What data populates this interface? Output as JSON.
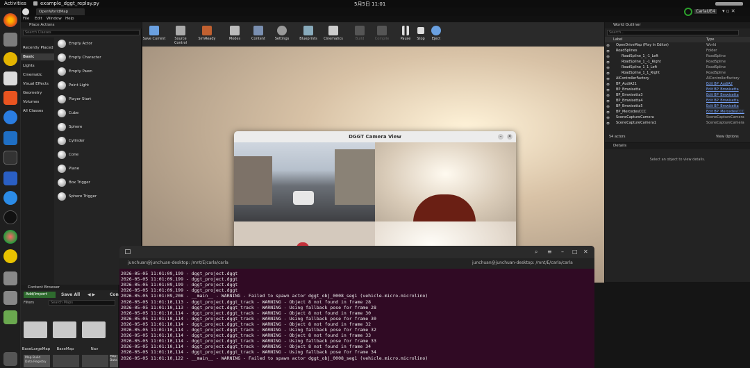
{
  "top_bar": {
    "activities": "Activities",
    "app_name": "example_dggt_replay.py",
    "clock": "5月5日  11:01"
  },
  "ue": {
    "tab": "OpenWorldMap",
    "menu": [
      "File",
      "Edit",
      "Window",
      "Help"
    ],
    "user_badge": "CarlaUE4",
    "place_actions": {
      "title": "Place Actions",
      "search_placeholder": "Search Classes",
      "categories": [
        "Recently Placed",
        "Basic",
        "Lights",
        "Cinematic",
        "Visual Effects",
        "Geometry",
        "Volumes",
        "All Classes"
      ],
      "items": [
        "Empty Actor",
        "Empty Character",
        "Empty Pawn",
        "Point Light",
        "Player Start",
        "Cube",
        "Sphere",
        "Cylinder",
        "Cone",
        "Plane",
        "Box Trigger",
        "Sphere Trigger"
      ]
    },
    "toolbar": [
      "Save Current",
      "Source Control",
      "SimReady",
      "Modes",
      "Content",
      "Settings",
      "Blueprints",
      "Cinematics",
      "Build",
      "Compile",
      "Pause",
      "Stop",
      "Eject"
    ],
    "outliner": {
      "title": "World Outliner",
      "search_placeholder": "Search...",
      "col_label": "Label",
      "col_type": "Type",
      "rows": [
        {
          "label": "OpenDriveMap (Play In Editor)",
          "type": "World",
          "link": false
        },
        {
          "label": "RoadSplines",
          "type": "Folder",
          "link": false
        },
        {
          "label": "RoadSpline_1_-1_Left",
          "type": "RoadSpline",
          "link": false
        },
        {
          "label": "RoadSpline_1_-1_Right",
          "type": "RoadSpline",
          "link": false
        },
        {
          "label": "RoadSpline_1_1_Left",
          "type": "RoadSpline",
          "link": false
        },
        {
          "label": "RoadSpline_1_1_Right",
          "type": "RoadSpline",
          "link": false
        },
        {
          "label": "AIControllerFactory",
          "type": "AIControllerFactory",
          "link": false
        },
        {
          "label": "BP_AudiA21",
          "type": "Edit BP_AudiA2",
          "link": true
        },
        {
          "label": "BP_Bmwisetta",
          "type": "Edit BP_Bmwisetta",
          "link": true
        },
        {
          "label": "BP_Bmwisetta3",
          "type": "Edit BP_Bmwisetta",
          "link": true
        },
        {
          "label": "BP_Bmwisetta4",
          "type": "Edit BP_Bmwisetta",
          "link": true
        },
        {
          "label": "BP_Bmwisetta5",
          "type": "Edit BP_Bmwisetta",
          "link": true
        },
        {
          "label": "BP_MercedesCCC",
          "type": "Edit BP_MercedesCCC",
          "link": true
        },
        {
          "label": "SceneCaptureCamera",
          "type": "SceneCaptureCamera",
          "link": false
        },
        {
          "label": "SceneCaptureCamera1",
          "type": "SceneCaptureCamera",
          "link": false
        }
      ],
      "count": "54 actors",
      "view_options": "View Options"
    },
    "details": {
      "title": "Details",
      "empty_text": "Select an object to view details."
    },
    "content_browser": {
      "title": "Content Browser",
      "add_import": "Add/Import",
      "save_all": "Save All",
      "path_fragment": "Con",
      "filters": "Filters",
      "search_placeholder": "Search Maps",
      "folders": [
        "BaseLargeMap",
        "BaseMap",
        "Nav"
      ],
      "bottom_item": "Map Build Data Registry",
      "bottom_item2": "Map Data"
    }
  },
  "camera_window": {
    "title": "DGGT Camera View"
  },
  "terminal": {
    "title": "junchuan@junchuan-desktop: /mnt/E/carla/carla",
    "title2": "junchuan@junchuan-desktop: /mnt/E/carla/carla",
    "lines": [
      "2026-05-05 11:01:09,199 - dggt_project.dggt",
      "2026-05-05 11:01:09,199 - dggt_project.dggt",
      "2026-05-05 11:01:09,199 - dggt_project.dggt",
      "2026-05-05 11:01:09,199 - dggt_project.dggt",
      "2026-05-05 11:01:09,208 - __main__ - WARNING - Failed to spawn actor dggt_obj_0008_seg1 (vehicle.micro.microlino)",
      "2026-05-05 11:01:10,113 - dggt_project.dggt_track - WARNING - Object 8 not found in frame 28",
      "2026-05-05 11:01:10,113 - dggt_project.dggt_track - WARNING - Using fallback pose for frame 28",
      "2026-05-05 11:01:10,114 - dggt_project.dggt_track - WARNING - Object 8 not found in frame 30",
      "2026-05-05 11:01:10,114 - dggt_project.dggt_track - WARNING - Using fallback pose for frame 30",
      "2026-05-05 11:01:10,114 - dggt_project.dggt_track - WARNING - Object 8 not found in frame 32",
      "2026-05-05 11:01:10,114 - dggt_project.dggt_track - WARNING - Using fallback pose for frame 32",
      "2026-05-05 11:01:10,114 - dggt_project.dggt_track - WARNING - Object 8 not found in frame 33",
      "2026-05-05 11:01:10,114 - dggt_project.dggt_track - WARNING - Using fallback pose for frame 33",
      "2026-05-05 11:01:10,114 - dggt_project.dggt_track - WARNING - Object 8 not found in frame 34",
      "2026-05-05 11:01:10,114 - dggt_project.dggt_track - WARNING - Using fallback pose for frame 34",
      "2026-05-05 11:01:10,122 - __main__ - WARNING - Failed to spawn actor dggt_obj_0008_seg1 (vehicle.micro.microlino)"
    ]
  }
}
